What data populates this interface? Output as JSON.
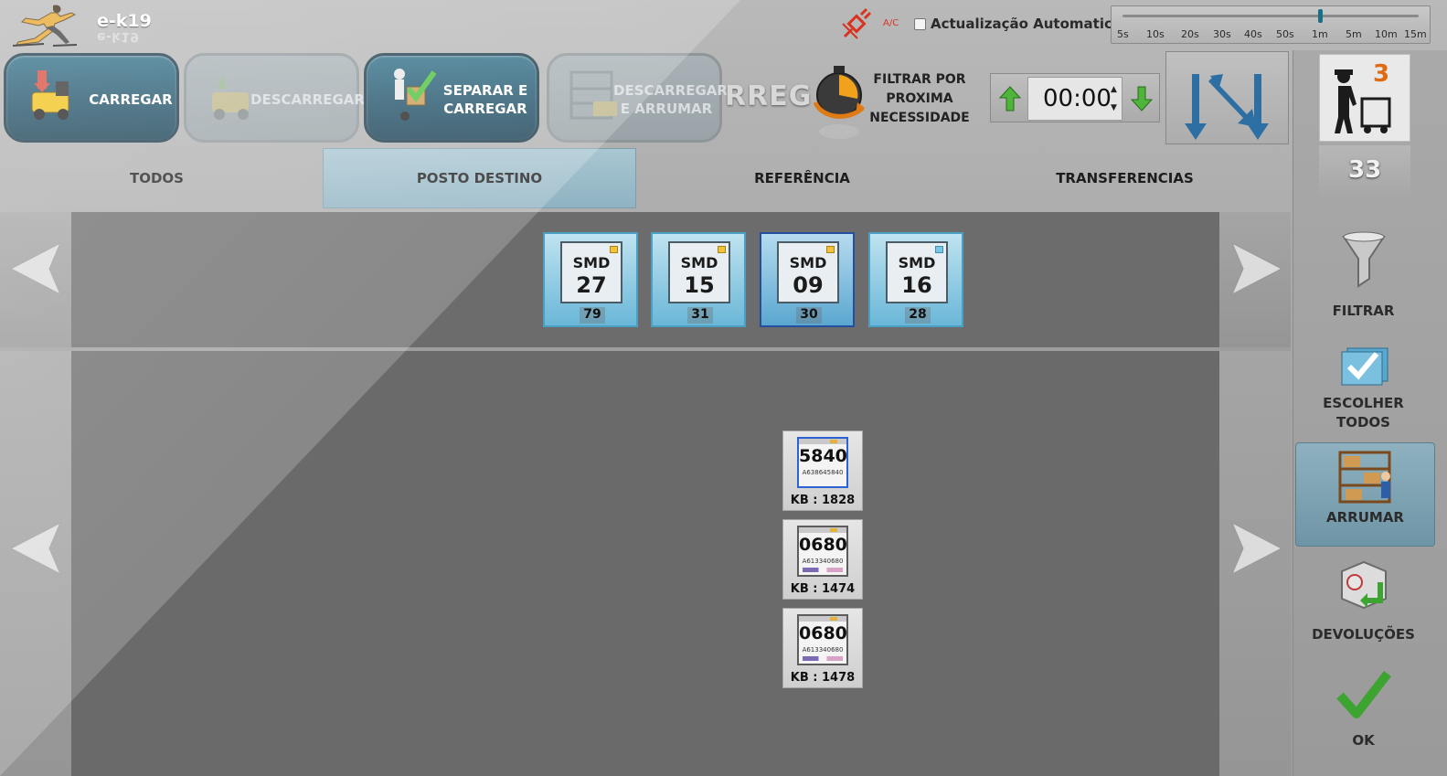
{
  "app": {
    "title": "e-k19",
    "title_reflection": "e-k19"
  },
  "topbar": {
    "ac_label": "A/C",
    "auto_update_label": "Actualização Automatica",
    "auto_update_checked": false,
    "interval_ticks": [
      "5s",
      "10s",
      "20s",
      "30s",
      "40s",
      "50s",
      "1m",
      "5m",
      "10m",
      "15m"
    ],
    "interval_selected": "1m"
  },
  "modes": [
    {
      "id": "carregar",
      "label": "CARREGAR",
      "active": true
    },
    {
      "id": "descarregar",
      "label": "DESCARREGAR",
      "active": false
    },
    {
      "id": "separar",
      "label_line1": "SEPARAR E",
      "label_line2": "CARREGAR",
      "active": true
    },
    {
      "id": "descarregar-arrumar",
      "label_line1": "DESCARREGAR",
      "label_line2": "E ARRUMAR",
      "active": false
    }
  ],
  "overflow_title": "RREG",
  "filter_next": {
    "line1": "FILTRAR POR",
    "line2": "PROXIMA",
    "line3": "NECESSIDADE"
  },
  "timer": {
    "value": "00:00"
  },
  "worker": {
    "count": "3",
    "reflection": "33"
  },
  "tabs": [
    {
      "label": "TODOS",
      "active": false
    },
    {
      "label": "POSTO DESTINO",
      "active": true
    },
    {
      "label": "REFERÊNCIA",
      "active": false
    },
    {
      "label": "TRANSFERENCIAS",
      "active": false
    }
  ],
  "smd_cards": [
    {
      "tag": "SMD",
      "number": "27",
      "count": "79",
      "selected": false,
      "corner": "yellow"
    },
    {
      "tag": "SMD",
      "number": "15",
      "count": "31",
      "selected": false,
      "corner": "yellow"
    },
    {
      "tag": "SMD",
      "number": "09",
      "count": "30",
      "selected": true,
      "corner": "yellow"
    },
    {
      "tag": "SMD",
      "number": "16",
      "count": "28",
      "selected": false,
      "corner": "blue"
    }
  ],
  "kb_cards": [
    {
      "code": "5840",
      "sub": "A638645840",
      "label": "KB : 1828",
      "border": "blue"
    },
    {
      "code": "0680",
      "sub": "A613340680",
      "label": "KB : 1474",
      "border": "dark"
    },
    {
      "code": "0680",
      "sub": "A613340680",
      "label": "KB : 1478",
      "border": "dark"
    }
  ],
  "side_actions": [
    {
      "id": "filtrar",
      "line1": "FILTRAR",
      "line2": "",
      "active": false
    },
    {
      "id": "escolher",
      "line1": "ESCOLHER",
      "line2": "TODOS",
      "active": false
    },
    {
      "id": "arrumar",
      "line1": "ARRUMAR",
      "line2": "",
      "active": true
    },
    {
      "id": "devolucoes",
      "line1": "DEVOLUÇÕES",
      "line2": "",
      "active": false
    },
    {
      "id": "ok",
      "line1": "OK",
      "line2": "",
      "active": false
    }
  ],
  "colors": {
    "accent": "#1f5269",
    "active_tab": "#8fb3c2",
    "content_bg": "#6c6c6c",
    "alert": "#d8331f",
    "count_orange": "#e06a12"
  }
}
